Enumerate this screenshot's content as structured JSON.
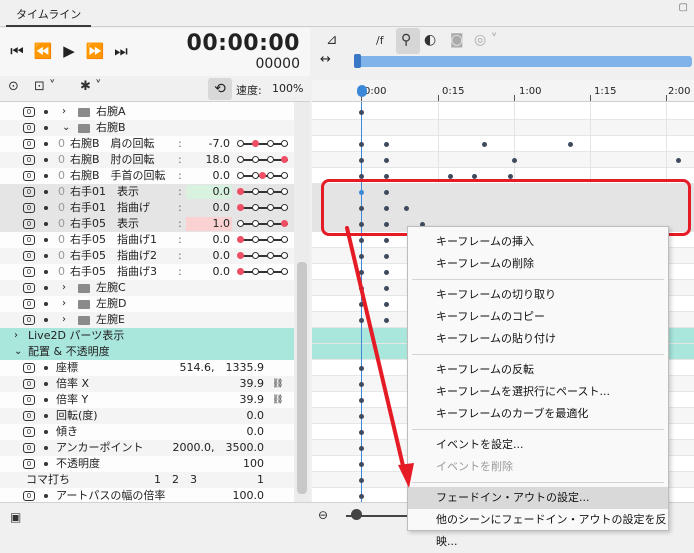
{
  "tab": {
    "title": "タイムライン"
  },
  "time": {
    "main": "00:00:00",
    "frame": "00000"
  },
  "speed": {
    "label": "速度:",
    "value": "100%"
  },
  "toolbar": {
    "fps": "/f"
  },
  "ruler": [
    "0:00",
    "0:15",
    "1:00",
    "1:15",
    "2:00"
  ],
  "layers": [
    {
      "kind": "folder",
      "name": "右腕A",
      "expanded": false
    },
    {
      "kind": "folder",
      "name": "右腕B",
      "expanded": true
    },
    {
      "kind": "param",
      "name": "右腕B　肩の回転",
      "value": "-7.0",
      "slider": 0.36
    },
    {
      "kind": "param",
      "name": "右腕B　肘の回転",
      "value": "18.0",
      "slider": 1.0
    },
    {
      "kind": "param",
      "name": "右腕B　手首の回転",
      "value": "0.0",
      "slider": 0.5
    },
    {
      "kind": "param",
      "name": "右手01　表示",
      "value": "0.0",
      "slider": 0.0,
      "highlight": "#d9f1df"
    },
    {
      "kind": "param",
      "name": "右手01　指曲げ",
      "value": "0.0",
      "slider": 0.0
    },
    {
      "kind": "param",
      "name": "右手05　表示",
      "value": "1.0",
      "slider": 1.0,
      "highlight": "#fad2d2"
    },
    {
      "kind": "param",
      "name": "右手05　指曲げ1",
      "value": "0.0",
      "slider": 0.0
    },
    {
      "kind": "param",
      "name": "右手05　指曲げ2",
      "value": "0.0",
      "slider": 0.0
    },
    {
      "kind": "param",
      "name": "右手05　指曲げ3",
      "value": "0.0",
      "slider": 0.0
    },
    {
      "kind": "folder",
      "name": "左腕C",
      "expanded": false
    },
    {
      "kind": "folder",
      "name": "左腕D",
      "expanded": false
    },
    {
      "kind": "folder",
      "name": "左腕E",
      "expanded": false
    },
    {
      "kind": "section",
      "name": "Live2D パーツ表示",
      "expanded": false
    },
    {
      "kind": "section",
      "name": "配置 & 不透明度",
      "expanded": true
    },
    {
      "kind": "prop",
      "name": "座標",
      "value": "514.6,　1335.9"
    },
    {
      "kind": "prop",
      "name": "倍率 X",
      "value": "39.9",
      "link": true
    },
    {
      "kind": "prop",
      "name": "倍率 Y",
      "value": "39.9",
      "link": true
    },
    {
      "kind": "prop",
      "name": "回転(度)",
      "value": "0.0"
    },
    {
      "kind": "prop",
      "name": "傾き",
      "value": "0.0"
    },
    {
      "kind": "prop",
      "name": "アンカーポイント",
      "value": "2000.0,　3500.0"
    },
    {
      "kind": "prop",
      "name": "不透明度",
      "value": "100"
    },
    {
      "kind": "koma",
      "name": "コマ打ち",
      "nums": "1　2　3",
      "value": "1"
    },
    {
      "kind": "prop",
      "name": "アートパスの幅の倍率",
      "value": "100.0"
    }
  ],
  "menu": {
    "items": [
      {
        "label": "キーフレームの挿入"
      },
      {
        "label": "キーフレームの削除"
      },
      {
        "sep": true
      },
      {
        "label": "キーフレームの切り取り"
      },
      {
        "label": "キーフレームのコピー"
      },
      {
        "label": "キーフレームの貼り付け"
      },
      {
        "sep": true
      },
      {
        "label": "キーフレームの反転"
      },
      {
        "label": "キーフレームを選択行にペースト..."
      },
      {
        "label": "キーフレームのカーブを最適化"
      },
      {
        "sep": true
      },
      {
        "label": "イベントを設定..."
      },
      {
        "label": "イベントを削除",
        "disabled": true
      },
      {
        "sep": true
      },
      {
        "label": "フェードイン・アウトの設定...",
        "highlight": true
      },
      {
        "label": "他のシーンにフェードイン・アウトの設定を反映..."
      }
    ]
  },
  "colors": {
    "accent": "#3c88d8",
    "annotation": "#e51c25",
    "section": "#a9e7dd"
  }
}
